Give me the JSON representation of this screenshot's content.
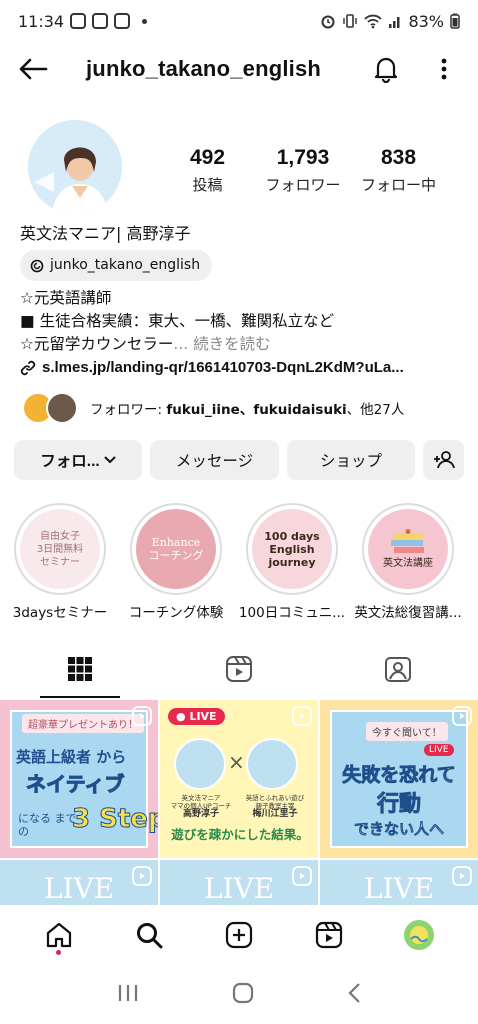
{
  "status": {
    "time": "11:34",
    "battery": "83%"
  },
  "header": {
    "username": "junko_takano_english"
  },
  "stats": [
    {
      "num": "492",
      "label": "投稿"
    },
    {
      "num": "1,793",
      "label": "フォロワー"
    },
    {
      "num": "838",
      "label": "フォロー中"
    }
  ],
  "bio": {
    "name": "英文法マニア| 高野淳子",
    "threads": "junko_takano_english",
    "line1": "☆元英語講師",
    "line2": "■ 生徒合格実績：東大、一橋、難関私立など",
    "line3": "☆元留学カウンセラー",
    "line3_suffix": "... 続きを読む",
    "link": "s.lmes.jp/landing-qr/1661410703-DqnL2KdM?uLa..."
  },
  "followed_by": {
    "prefix": "フォロワー: ",
    "names": "fukui_iine、fukuidaisuki",
    "suffix": "、他27人"
  },
  "buttons": {
    "follow": "フォロ...",
    "message": "メッセージ",
    "shop": "ショップ"
  },
  "highlights": [
    {
      "caption": "3daysセミナー",
      "inner": "自由女子\n3日間無料\nセミナー",
      "color": "#f8eaec",
      "text_color": "#a0727c"
    },
    {
      "caption": "コーチング体験",
      "inner": "Enhance\nコーチング",
      "color": "#e8aab0",
      "text_color": "#ffffff"
    },
    {
      "caption": "100日コミュニ...",
      "inner": "100 days\nEnglish\njourney",
      "color": "#f7d7db",
      "text_color": "#3a2a1a"
    },
    {
      "caption": "英文法総復習講...",
      "inner": "英文法講座",
      "color": "#f5c6d0",
      "text_color": "#3a2a1a"
    }
  ],
  "posts": [
    {
      "line_a": "超豪華プレゼントあり！",
      "line_b": "英語上級者 から",
      "line_c": "ネイティブ",
      "line_d": "になる までの",
      "line_e": "3 Step"
    },
    {
      "live": "LIVE",
      "left_title": "英文法マニア",
      "left_sub": "ママの個人UPコーチ",
      "left_name": "高野淳子",
      "right_title": "英語とふれあい遊び",
      "right_sub": "親子教室主宰",
      "right_name": "梅川江里子",
      "caption": "遊びを疎かにした結果。"
    },
    {
      "top": "今すぐ聞いて！",
      "live": "LIVE",
      "big1": "失敗を恐れて",
      "big2": "行動",
      "big3": "できない人へ"
    }
  ],
  "row2_label": "LIVE",
  "colors": {
    "accent_pink": "#f6b6c9",
    "sky": "#bfe0f0",
    "yellow": "#fff6b8",
    "gray_btn": "#efefef",
    "dot_red": "#e0245e"
  }
}
